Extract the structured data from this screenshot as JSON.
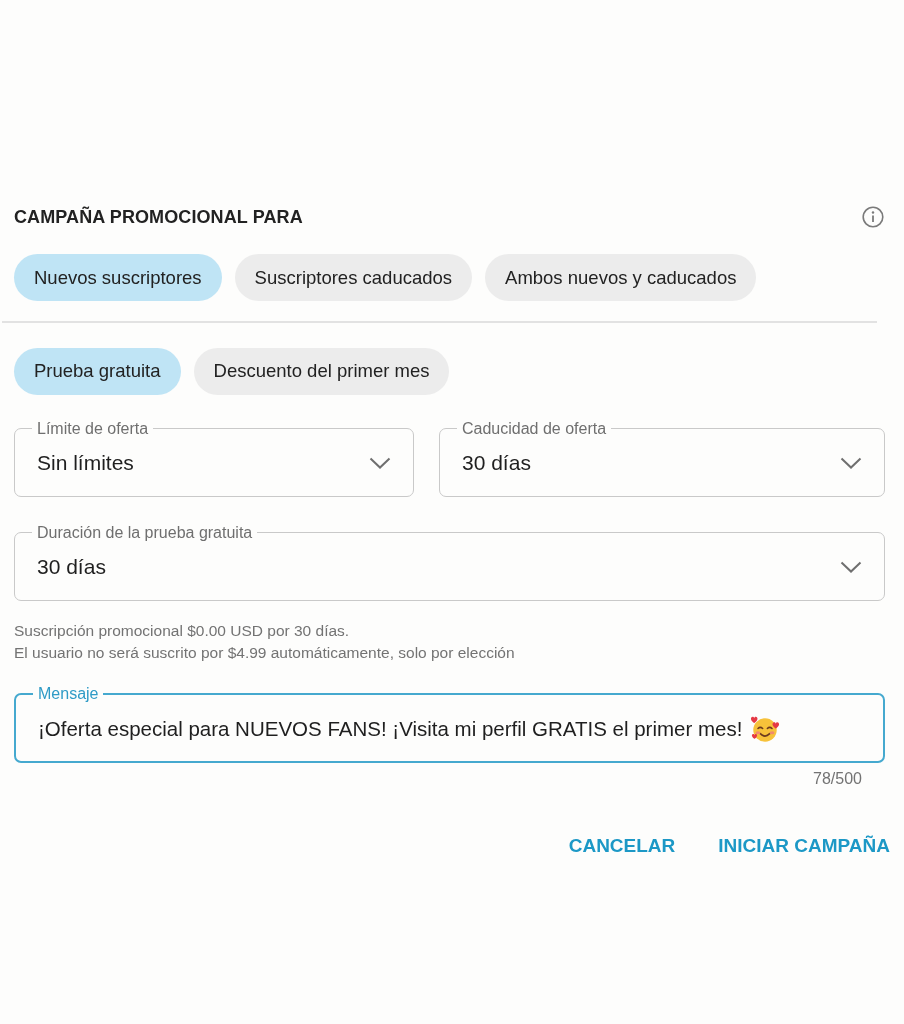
{
  "header": {
    "title": "CAMPAÑA PROMOCIONAL PARA"
  },
  "audience_chips": [
    {
      "label": "Nuevos suscriptores",
      "selected": true
    },
    {
      "label": "Suscriptores caducados",
      "selected": false
    },
    {
      "label": "Ambos nuevos y caducados",
      "selected": false
    }
  ],
  "offer_type_chips": [
    {
      "label": "Prueba gratuita",
      "selected": true
    },
    {
      "label": "Descuento del primer mes",
      "selected": false
    }
  ],
  "field_rows": [
    [
      {
        "label": "Límite de oferta",
        "value": "Sin límites"
      },
      {
        "label": "Caducidad de oferta",
        "value": "30 días"
      }
    ],
    [
      {
        "label": "Duración de la prueba gratuita",
        "value": "30 días"
      }
    ]
  ],
  "summary": [
    "Suscripción promocional $0.00 USD por 30 días.",
    "El usuario no será suscrito por $4.99 automáticamente, solo por elección"
  ],
  "message": {
    "label": "Mensaje",
    "value": "¡Oferta especial para NUEVOS FANS! ¡Visita mi perfil GRATIS el primer mes!",
    "focused": true,
    "counter": "78/500"
  },
  "buttons": [
    {
      "label": "CANCELAR"
    },
    {
      "label": "INICIAR CAMPAÑA"
    }
  ]
}
